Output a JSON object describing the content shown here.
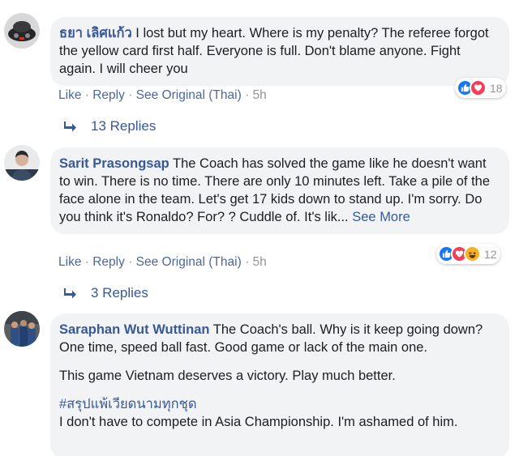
{
  "comments": [
    {
      "author": "ธยา เลิศแก้ว",
      "text": "I lost but my heart. Where is my penalty? The referee forgot the yellow card first half. Everyone is full. Don't blame anyone. Fight again. I will cheer you",
      "actions": {
        "like": "Like",
        "reply": "Reply",
        "see_original": "See Original (Thai)",
        "sep": "·",
        "time": "5h"
      },
      "reaction_count": "18",
      "replies_label": "13 Replies"
    },
    {
      "author": "Sarit Prasongsap",
      "text": "The Coach has solved the game like he doesn't want to win. There is no time. There are only 10 minutes left. Take a pile of the face alone in the team. Let's get 17 kids down to stand up. I'm sorry. Do you think it's Ronaldo? For? ? Cuddle of. It's lik...",
      "see_more": "See More",
      "actions": {
        "like": "Like",
        "reply": "Reply",
        "see_original": "See Original (Thai)",
        "sep": "·",
        "time": "5h"
      },
      "reaction_count": "12",
      "replies_label": "3 Replies"
    },
    {
      "author": "Saraphan Wut Wuttinan",
      "text": "The Coach's ball. Why is it keep going down? One time, speed ball fast. Good game or lack of the main one.",
      "paragraph2": "This game Vietnam deserves a victory. Play much better.",
      "hashtag": "#สรุปแพ้เวียดนามทุกชุด",
      "paragraph3": "I don't have to compete in Asia Championship. I'm ashamed of him."
    }
  ],
  "colors": {
    "link": "#385898",
    "meta": "#90949c",
    "bubble": "#f2f3f5",
    "like": "#1877f2",
    "love": "#f33e58",
    "haha": "#f7b125"
  },
  "icons": {
    "like": "thumbs-up-icon",
    "love": "heart-icon",
    "haha": "laughing-face-icon",
    "reply_arrow": "reply-arrow-icon"
  }
}
